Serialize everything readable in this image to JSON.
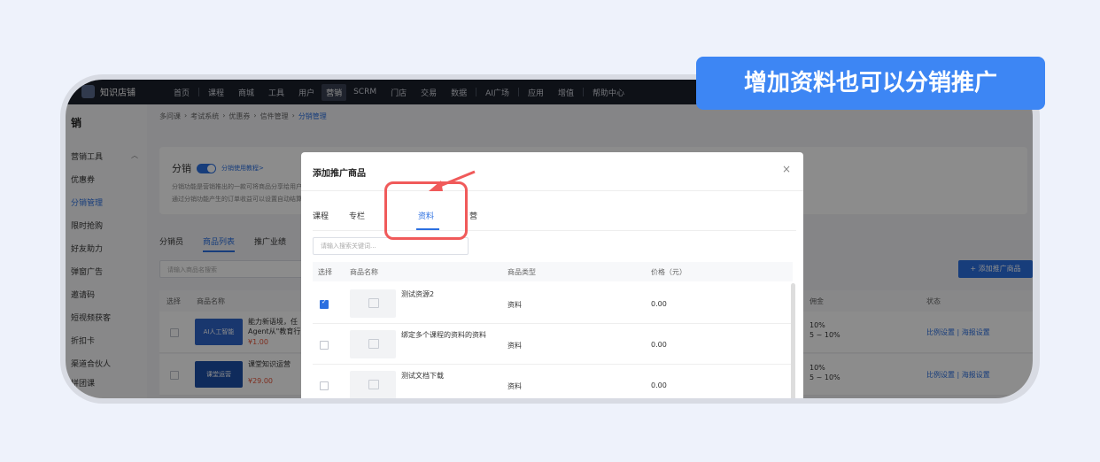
{
  "app": {
    "logo_text": "知识店铺",
    "nav": [
      "首页",
      "课程",
      "商城",
      "工具",
      "用户",
      "营销",
      "SCRM",
      "门店",
      "交易",
      "数据",
      "AI广场",
      "应用",
      "增值",
      "帮助中心"
    ],
    "nav_active": "营销"
  },
  "sidebar": {
    "title": "销",
    "group": "营销工具",
    "items": [
      "优惠券",
      "分销管理",
      "限时抢购",
      "好友助力",
      "弹窗广告",
      "邀请码",
      "短视频获客",
      "折扣卡",
      "渠道合伙人",
      "拼团课"
    ],
    "active": "分销管理"
  },
  "breadcrumb": [
    "多问课",
    "考试系统",
    "优惠券",
    "信件管理",
    "分销管理"
  ],
  "distribution": {
    "label": "分销",
    "help_link": "分销使用教程>",
    "desc1": "分销功能是营销推出的一款可将商品分享给用户推广的",
    "desc2": "通过分销功能产生的订单收益可以设置自动结算"
  },
  "main_tabs": [
    "分销员",
    "商品列表",
    "推广业绩"
  ],
  "main_tab_active": "商品列表",
  "search_placeholder": "请输入商品名搜索",
  "add_button": "+ 添加推广商品",
  "table": {
    "headers": [
      "选择",
      "商品名称",
      "佣金",
      "状态"
    ],
    "rows": [
      {
        "title1": "能力新语境，任",
        "title2": "Agent从\"教育行",
        "price": "¥1.00",
        "thumb_text": "AI人工智能",
        "ratio1": "10%",
        "ratio2": "5 ~ 10%",
        "op1": "比例设置",
        "op2": "海报设置"
      },
      {
        "title1": "课堂知识运营",
        "title2": "",
        "price": "¥29.00",
        "thumb_text": "课堂运营",
        "ratio1": "10%",
        "ratio2": "5 ~ 10%",
        "op1": "比例设置",
        "op2": "海报设置"
      }
    ]
  },
  "modal": {
    "title": "添加推广商品",
    "close": "×",
    "tabs": [
      "课程",
      "专栏",
      "资料",
      "营"
    ],
    "tab_active": "资料",
    "search_placeholder": "请输入搜索关键词...",
    "headers": [
      "选择",
      "商品名称",
      "商品类型",
      "价格（元）"
    ],
    "rows": [
      {
        "name": "测试资源2",
        "type": "资料",
        "price": "0.00",
        "checked": true
      },
      {
        "name": "绑定多个课程的资料的资料",
        "type": "资料",
        "price": "0.00",
        "checked": false
      },
      {
        "name": "测试文档下载",
        "type": "资料",
        "price": "0.00",
        "checked": false
      }
    ]
  },
  "callout": "增加资料也可以分销推广",
  "colors": {
    "accent": "#2b6fe0",
    "callout": "#3d86f4",
    "highlight": "#f05a5a",
    "nav_bg": "#1b1f2a"
  }
}
